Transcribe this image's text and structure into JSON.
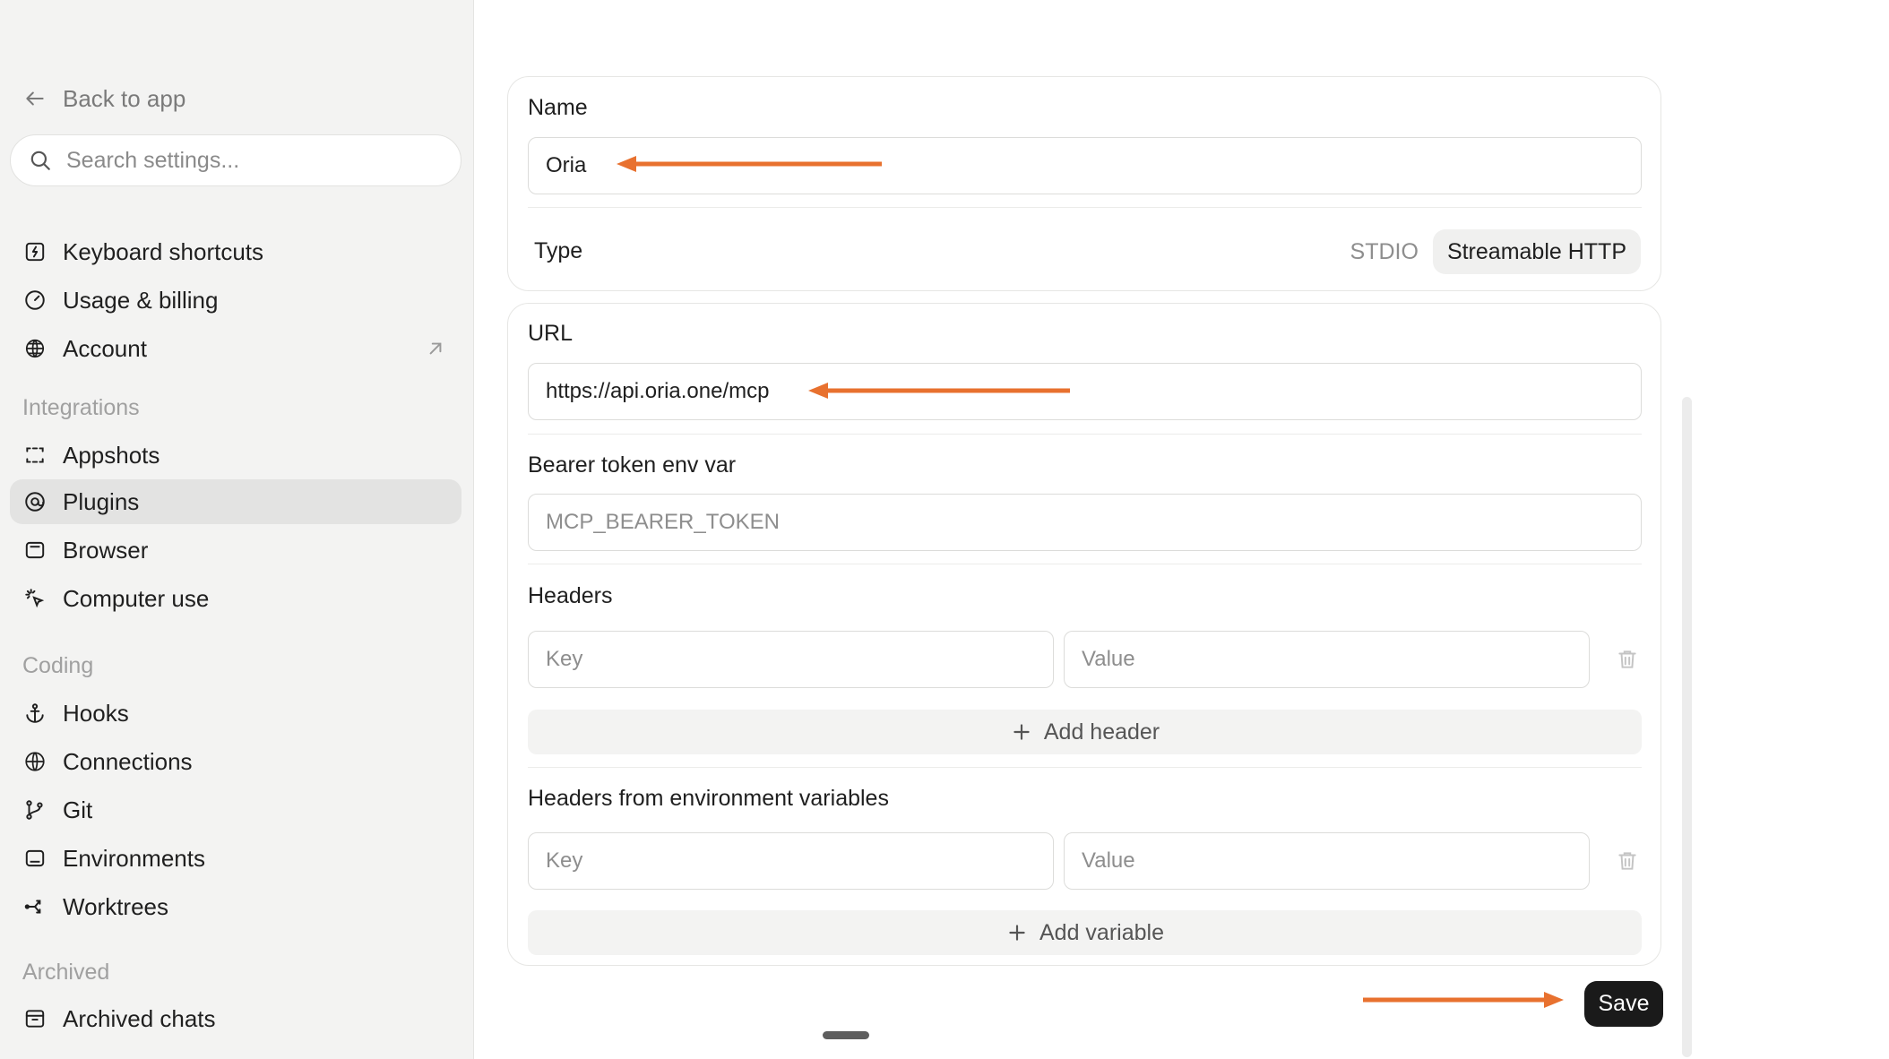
{
  "sidebar": {
    "back_label": "Back to app",
    "search_placeholder": "Search settings...",
    "items_top": [
      {
        "label": "Keyboard shortcuts",
        "icon": "keyboard-icon"
      },
      {
        "label": "Usage & billing",
        "icon": "gauge-icon"
      },
      {
        "label": "Account",
        "icon": "account-icon",
        "external": true
      }
    ],
    "integrations_label": "Integrations",
    "integrations": [
      {
        "label": "Appshots",
        "icon": "appshots-icon"
      },
      {
        "label": "Plugins",
        "icon": "plugins-icon",
        "active": true
      },
      {
        "label": "Browser",
        "icon": "browser-icon"
      },
      {
        "label": "Computer use",
        "icon": "cursor-click-icon"
      }
    ],
    "coding_label": "Coding",
    "coding": [
      {
        "label": "Hooks",
        "icon": "anchor-icon"
      },
      {
        "label": "Connections",
        "icon": "globe-icon"
      },
      {
        "label": "Git",
        "icon": "git-branch-icon"
      },
      {
        "label": "Environments",
        "icon": "environment-icon"
      },
      {
        "label": "Worktrees",
        "icon": "worktree-icon"
      }
    ],
    "archived_label": "Archived",
    "archived": [
      {
        "label": "Archived chats",
        "icon": "archive-icon"
      }
    ]
  },
  "form": {
    "name_label": "Name",
    "name_value": "Oria",
    "type_label": "Type",
    "type_options": [
      "STDIO",
      "Streamable HTTP"
    ],
    "type_selected": "Streamable HTTP",
    "url_label": "URL",
    "url_value": "https://api.oria.one/mcp",
    "bearer_label": "Bearer token env var",
    "bearer_placeholder": "MCP_BEARER_TOKEN",
    "headers_label": "Headers",
    "key_placeholder": "Key",
    "value_placeholder": "Value",
    "add_header_label": "Add header",
    "env_headers_label": "Headers from environment variables",
    "add_variable_label": "Add variable",
    "save_label": "Save"
  },
  "colors": {
    "annotation_arrow": "#e8712f",
    "sidebar_bg": "#f3f3f2",
    "save_bg": "#1a1a1a"
  }
}
